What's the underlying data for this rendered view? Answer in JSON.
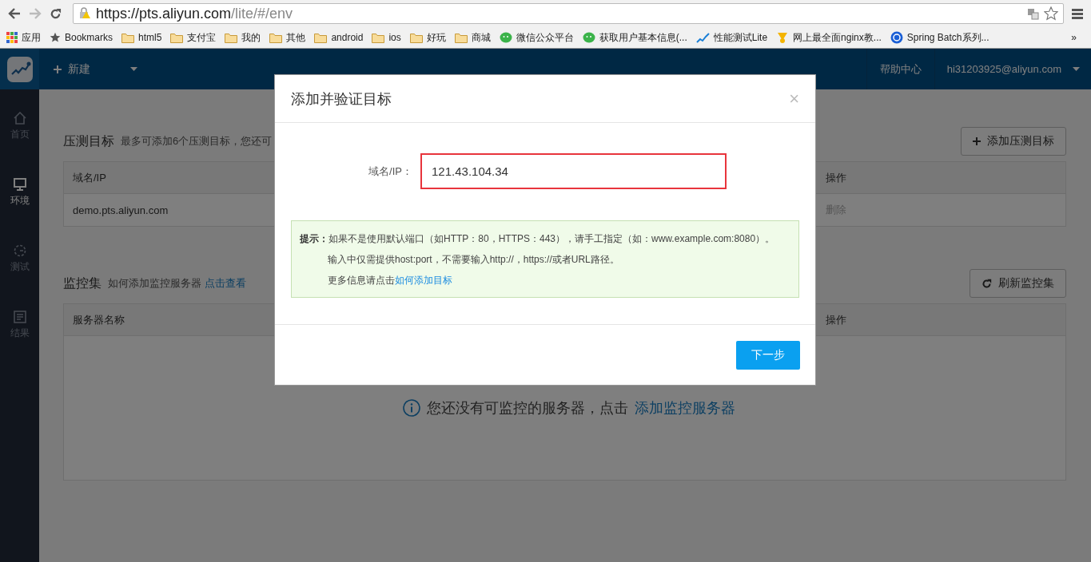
{
  "browser": {
    "url_host": "https://pts.aliyun.com",
    "url_path": "/lite/#/env",
    "bookmarks": [
      {
        "label": "应用",
        "kind": "apps"
      },
      {
        "label": "Bookmarks",
        "kind": "star"
      },
      {
        "label": "html5",
        "kind": "folder"
      },
      {
        "label": "支付宝",
        "kind": "folder"
      },
      {
        "label": "我的",
        "kind": "folder"
      },
      {
        "label": "其他",
        "kind": "folder"
      },
      {
        "label": "android",
        "kind": "folder"
      },
      {
        "label": "ios",
        "kind": "folder"
      },
      {
        "label": "好玩",
        "kind": "folder"
      },
      {
        "label": "商城",
        "kind": "folder"
      },
      {
        "label": "微信公众平台",
        "kind": "chat"
      },
      {
        "label": "获取用户基本信息(...",
        "kind": "chat"
      },
      {
        "label": "性能测试Lite",
        "kind": "chart"
      },
      {
        "label": "网上最全面nginx教...",
        "kind": "bell"
      },
      {
        "label": "Spring Batch系列...",
        "kind": "app"
      }
    ],
    "overflow": "»"
  },
  "header": {
    "new_label": "新建",
    "help": "帮助中心",
    "user": "hi31203925@aliyun.com"
  },
  "sidebar": {
    "items": [
      {
        "label": "首页",
        "kind": "home",
        "selected": false
      },
      {
        "label": "环境",
        "kind": "monitor",
        "selected": true
      },
      {
        "label": "测试",
        "kind": "gauge",
        "selected": false
      },
      {
        "label": "结果",
        "kind": "doc",
        "selected": false
      }
    ]
  },
  "targets": {
    "title": "压测目标",
    "note": "最多可添加6个压测目标，您还可",
    "button": "添加压测目标",
    "columns": [
      "域名/IP",
      "操作"
    ],
    "rows": [
      {
        "host": "demo.pts.aliyun.com",
        "action": "删除"
      }
    ]
  },
  "monitors": {
    "title": "监控集",
    "note": "如何添加监控服务器",
    "link": "点击查看",
    "button": "刷新监控集",
    "columns": [
      "服务器名称",
      "操作"
    ],
    "empty_text": "您还没有可监控的服务器，点击",
    "empty_link": "添加监控服务器"
  },
  "modal": {
    "title": "添加并验证目标",
    "close": "×",
    "field_label": "域名/IP：",
    "value": "121.43.104.34",
    "tip_label": "提示：",
    "tips": [
      "如果不是使用默认端口（如HTTP：80，HTTPS：443），请手工指定（如：www.example.com:8080）。",
      "输入中仅需提供host:port，不需要输入http://，https://或者URL路径。"
    ],
    "more_text": "更多信息请点击",
    "more_link": "如何添加目标",
    "next": "下一步"
  }
}
